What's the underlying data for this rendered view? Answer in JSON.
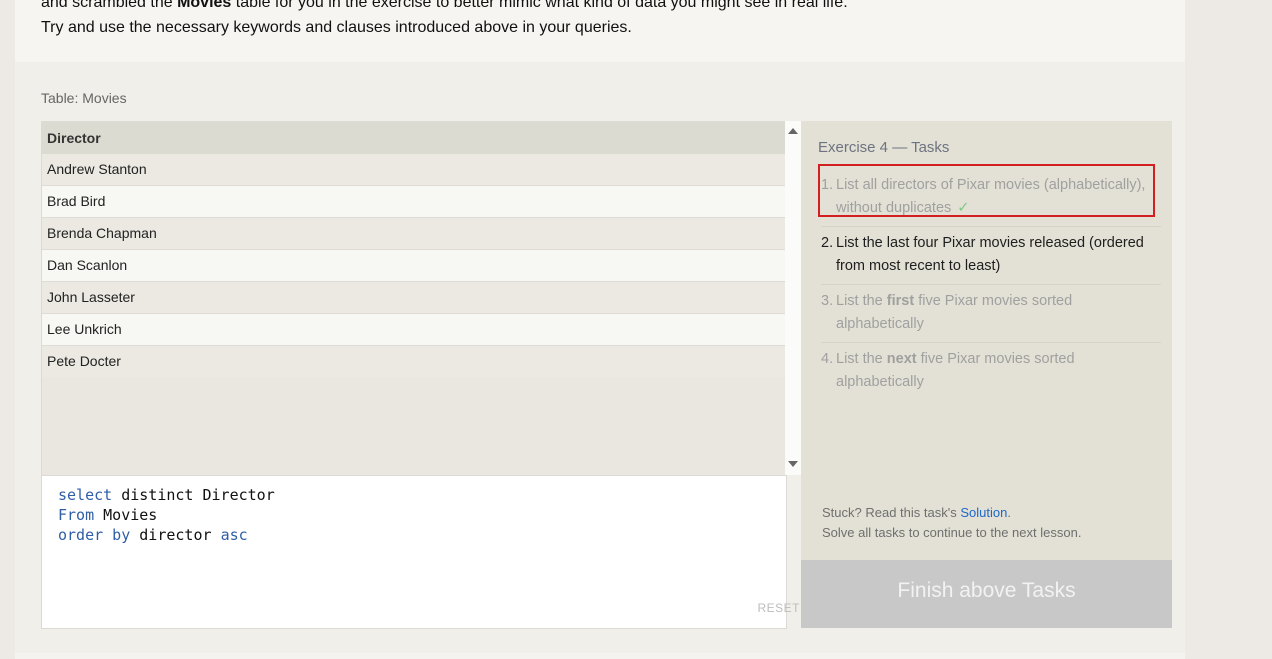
{
  "intro": {
    "line1_start": "and scrambled the ",
    "line1_bold": "Movies",
    "line1_end": " table for you in the exercise to better mimic what kind of data you might see in real life.",
    "line2": "Try and use the necessary keywords and clauses introduced above in your queries."
  },
  "table": {
    "caption": "Table: Movies",
    "header": "Director",
    "rows": [
      "Andrew Stanton",
      "Brad Bird",
      "Brenda Chapman",
      "Dan Scanlon",
      "John Lasseter",
      "Lee Unkrich",
      "Pete Docter"
    ]
  },
  "editor": {
    "line1_kw": "select",
    "line1_rest": " distinct Director",
    "line2_kw": "From",
    "line2_rest": " Movies",
    "line3_kw": "order by",
    "line3_mid": " director ",
    "line3_kw2": "asc",
    "reset_label": "RESET"
  },
  "tasks": {
    "title": "Exercise 4 — Tasks",
    "items": [
      {
        "num": "1.",
        "text": "List all directors of Pixar movies (alphabetically), without duplicates",
        "check": "✓"
      },
      {
        "num": "2.",
        "text": "List the last four Pixar movies released (ordered from most recent to least)"
      },
      {
        "num": "3.",
        "pre": "List the ",
        "bold": "first",
        "post": " five Pixar movies sorted alphabetically"
      },
      {
        "num": "4.",
        "pre": "List the ",
        "bold": "next",
        "post": " five Pixar movies sorted alphabetically"
      }
    ],
    "help_pre": "Stuck? Read this task's ",
    "help_link": "Solution",
    "help_post": ".",
    "help_line2": "Solve all tasks to continue to the next lesson.",
    "finish_label": "Finish above Tasks"
  },
  "colors": {
    "keyword": "#2f5ea6",
    "highlight": "#d31f1f",
    "check": "#7fc884",
    "link": "#1d68c9"
  }
}
